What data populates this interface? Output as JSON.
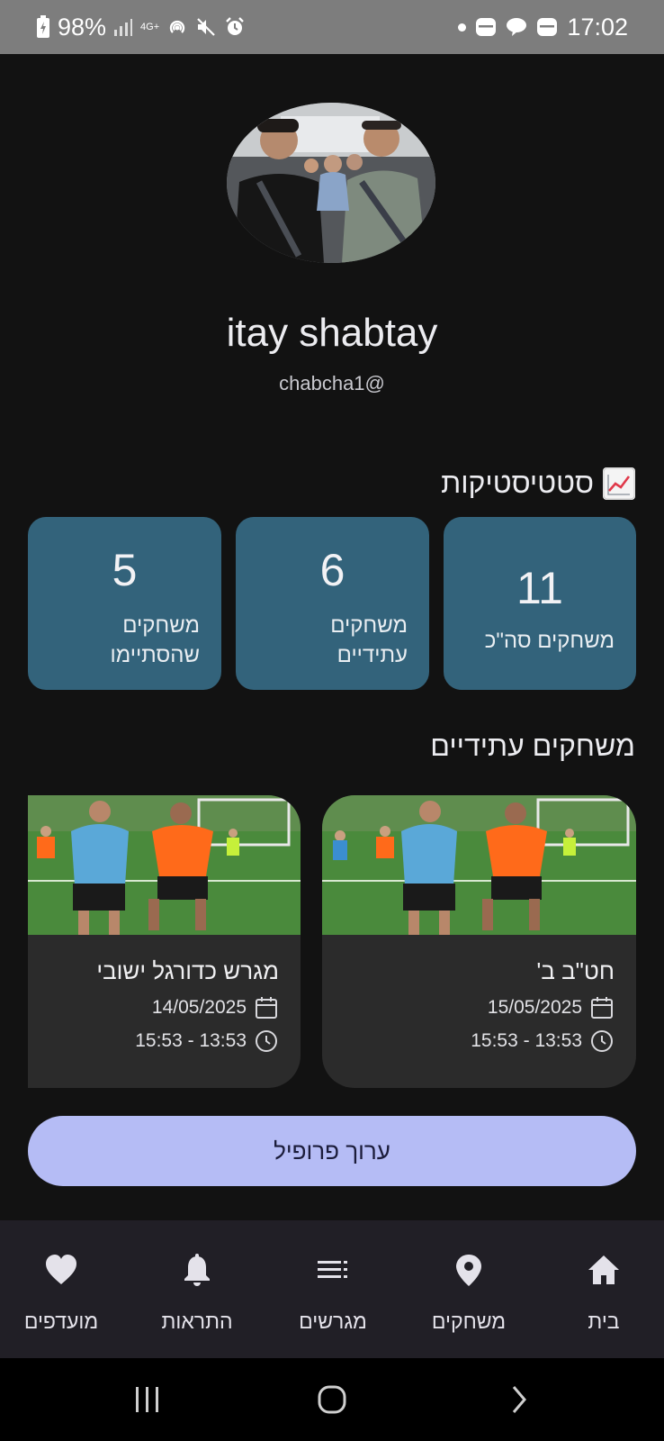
{
  "status_bar": {
    "battery": "98%",
    "network": "4G+",
    "time": "17:02"
  },
  "profile": {
    "name": "itay shabtay",
    "handle": "chabcha1@"
  },
  "stats": {
    "title": "סטטיסטיקות",
    "icon": "chart-increasing-icon",
    "cards": [
      {
        "value": "11",
        "label_line1": "משחקים סה\"כ",
        "label_line2": ""
      },
      {
        "value": "6",
        "label_line1": "משחקים",
        "label_line2": "עתידיים"
      },
      {
        "value": "5",
        "label_line1": "משחקים",
        "label_line2": "שהסתיימו"
      }
    ]
  },
  "upcoming": {
    "title": "משחקים עתידיים",
    "games": [
      {
        "title": "חט\"ב ב'",
        "date": "15/05/2025",
        "time": "15:53 - 13:53"
      },
      {
        "title": "מגרש כדורגל ישובי",
        "date": "14/05/2025",
        "time": "15:53 - 13:53"
      }
    ]
  },
  "edit_button": "ערוך פרופיל",
  "bottom_nav": [
    {
      "label": "בית",
      "icon": "home-icon"
    },
    {
      "label": "משחקים",
      "icon": "location-pin-icon"
    },
    {
      "label": "מגרשים",
      "icon": "list-icon"
    },
    {
      "label": "התראות",
      "icon": "bell-icon"
    },
    {
      "label": "מועדפים",
      "icon": "heart-icon"
    }
  ],
  "colors": {
    "background": "#121212",
    "stat_card": "#33637b",
    "game_card": "#2b2b2b",
    "edit_button": "#b5bcf5",
    "bottom_nav": "#211f26"
  }
}
